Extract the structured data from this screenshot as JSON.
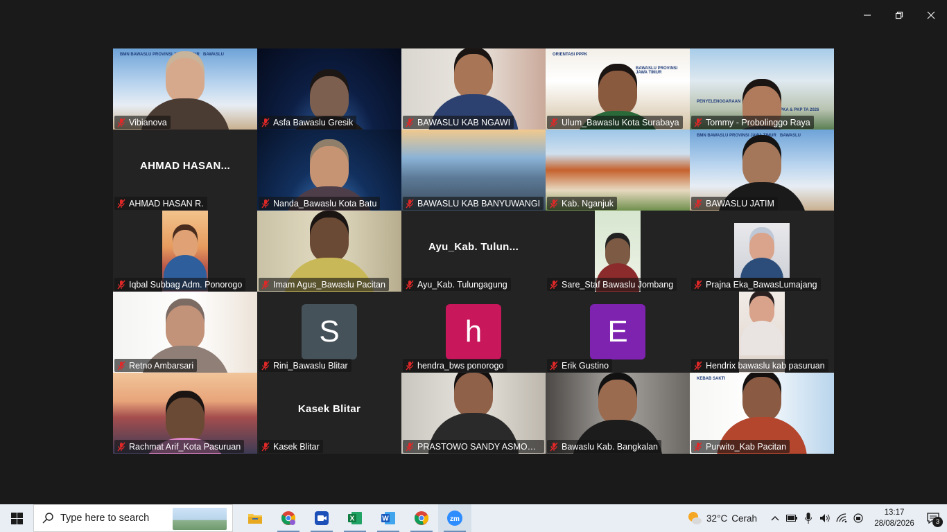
{
  "window": {
    "controls": [
      "minimize",
      "restore",
      "close"
    ]
  },
  "participants": [
    {
      "name": "Vibianova",
      "video": "banner-woman"
    },
    {
      "name": "Asfa Bawaslu Gresik",
      "video": "space-woman"
    },
    {
      "name": "BAWASLU KAB NGAWI",
      "video": "man-light"
    },
    {
      "name": "Ulum_Bawaslu Kota Surabaya",
      "video": "banner-man"
    },
    {
      "name": "Tommy - Probolinggo Raya",
      "video": "banner-building"
    },
    {
      "name": "AHMAD HASAN R.",
      "video": "none",
      "display_name": "AHMAD  HASAN..."
    },
    {
      "name": "Nanda_Bawaslu Kota Batu",
      "video": "space-woman2"
    },
    {
      "name": "BAWASLU KAB BANYUWANGI",
      "video": "mountain"
    },
    {
      "name": "Kab. Nganjuk",
      "video": "office-building"
    },
    {
      "name": "BAWASLU JATIM",
      "video": "banner-woman2",
      "active": true
    },
    {
      "name": "Iqbal Subbag Adm. Ponorogo",
      "video": "avatar-bridge"
    },
    {
      "name": "Imam Agus_Bawaslu Pacitan",
      "video": "man-room"
    },
    {
      "name": "Ayu_Kab. Tulungagung",
      "video": "none",
      "display_name": "Ayu_Kab.  Tulun..."
    },
    {
      "name": "Sare_Staf Bawaslu Jombang",
      "video": "portrait-man"
    },
    {
      "name": "Prajna Eka_BawasLumajang",
      "video": "portrait-woman"
    },
    {
      "name": "Retno Ambarsari",
      "video": "woman-bright"
    },
    {
      "name": "Rini_Bawaslu Blitar",
      "video": "letter",
      "letter": "S",
      "color": "#46525a"
    },
    {
      "name": "hendra_bws ponorogo",
      "video": "letter",
      "letter": "h",
      "color": "#c8175b"
    },
    {
      "name": "Erik Gustino",
      "video": "letter",
      "letter": "E",
      "color": "#7e22b0"
    },
    {
      "name": "Hendrix bawaslu kab pasuruan",
      "video": "portrait-man2"
    },
    {
      "name": "Rachmat Arif_Kota Pasuruan",
      "video": "bridge-sunset"
    },
    {
      "name": "Kasek Blitar",
      "video": "none",
      "display_name": "Kasek Blitar"
    },
    {
      "name": "PRASTOWO SANDY ASMORO...",
      "video": "man-room2"
    },
    {
      "name": "Bawaslu Kab. Bangkalan",
      "video": "man-dark"
    },
    {
      "name": "Purwito_Kab Pacitan",
      "video": "banner-man2"
    }
  ],
  "banners": {
    "bmn": "BMN BAWASLU PROVINSI JAWA TIMUR",
    "bawaslu": "BAWASLU",
    "orientasi": "ORIENTASI PPPK",
    "prov": "BAWASLU PROVINSI JAWA TIMUR",
    "penyelenggaraan": "PENYELENGGARAAN",
    "pka": "PKA & PKP TA 2026",
    "kebab": "KEBAB SAKTI"
  },
  "taskbar": {
    "search_placeholder": "Type here to search",
    "apps": [
      "file-explorer",
      "chrome-profile",
      "zoom-meetings",
      "excel",
      "word",
      "chrome",
      "zoom"
    ],
    "weather_temp": "32°C",
    "weather_desc": "Cerah",
    "time": "13:17",
    "date": "28/08/2026",
    "notifications": "3"
  }
}
